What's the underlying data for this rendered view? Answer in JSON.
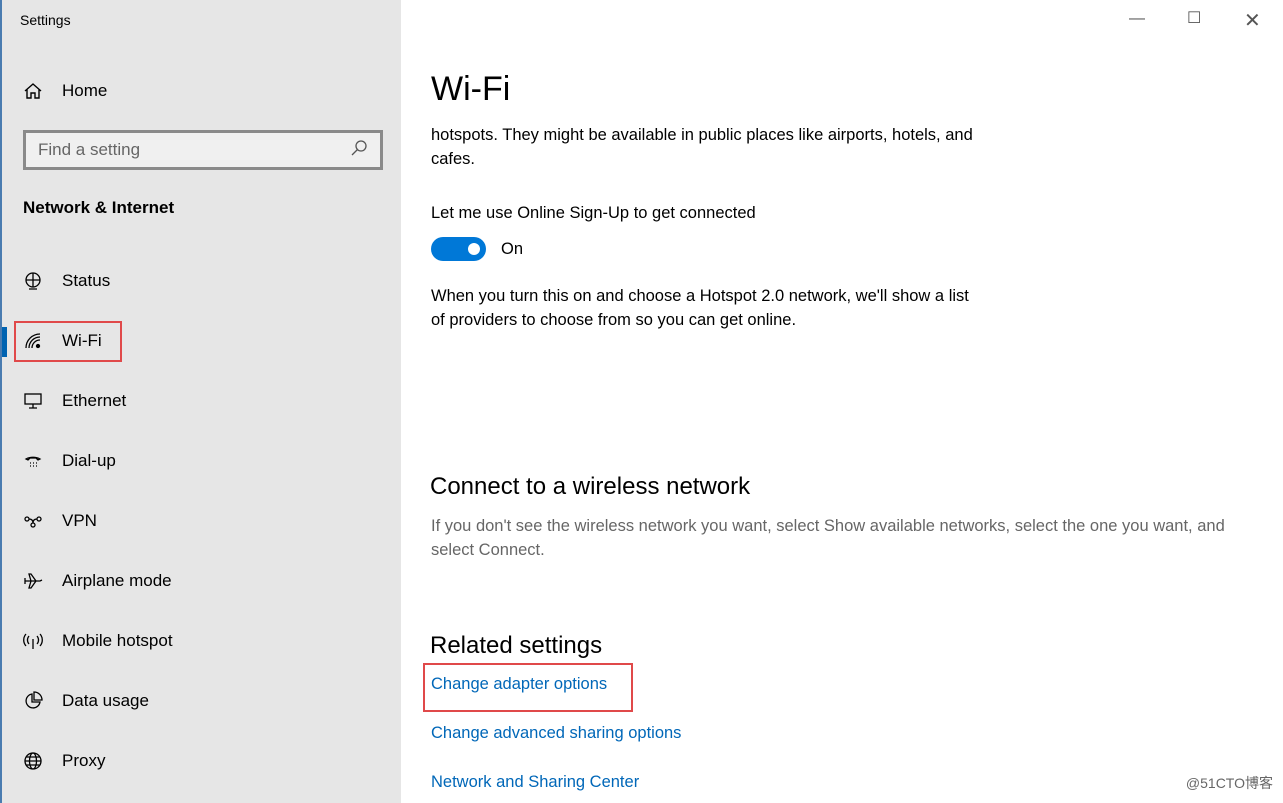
{
  "app": {
    "title": "Settings"
  },
  "sidebar": {
    "home": "Home",
    "search": {
      "placeholder": "Find a setting"
    },
    "section": "Network & Internet",
    "items": [
      {
        "label": "Status",
        "icon": "globe-monitor-icon"
      },
      {
        "label": "Wi-Fi",
        "icon": "wifi-icon",
        "selected": true
      },
      {
        "label": "Ethernet",
        "icon": "ethernet-icon"
      },
      {
        "label": "Dial-up",
        "icon": "phone-icon"
      },
      {
        "label": "VPN",
        "icon": "vpn-icon"
      },
      {
        "label": "Airplane mode",
        "icon": "airplane-icon"
      },
      {
        "label": "Mobile hotspot",
        "icon": "hotspot-icon"
      },
      {
        "label": "Data usage",
        "icon": "pie-icon"
      },
      {
        "label": "Proxy",
        "icon": "globe-icon"
      }
    ]
  },
  "main": {
    "title": "Wi-Fi",
    "intro": "hotspots. They might be available in public places like airports, hotels, and cafes.",
    "signup_label": "Let me use Online Sign-Up to get connected",
    "toggle": {
      "state": "On",
      "on": true
    },
    "signup_desc": "When you turn this on and choose a Hotspot 2.0 network, we'll show a list of providers to choose from so you can get online.",
    "connect_title": "Connect to a wireless network",
    "connect_desc": "If you don't see the wireless network you want, select Show available networks, select the one you want, and select Connect.",
    "related_title": "Related settings",
    "links": [
      "Change adapter options",
      "Change advanced sharing options",
      "Network and Sharing Center"
    ]
  },
  "colors": {
    "accent": "#0078d7",
    "link": "#0067b8",
    "highlight": "#e0494a"
  },
  "watermark": "@51CTO博客"
}
